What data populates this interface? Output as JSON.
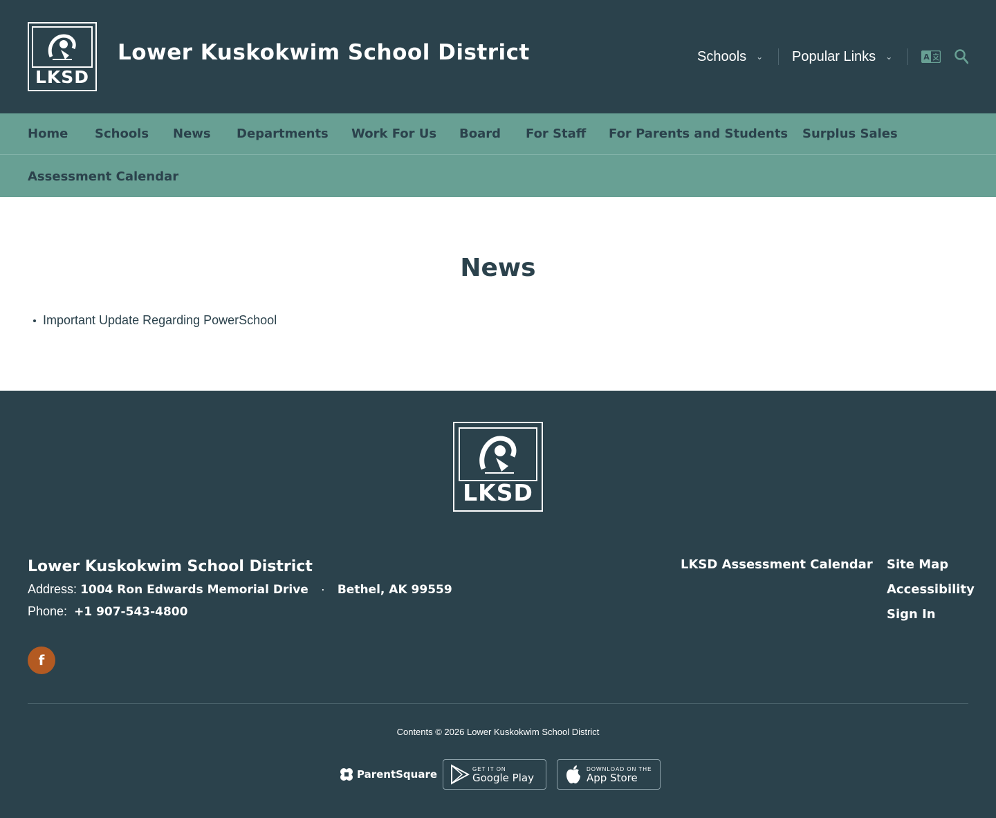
{
  "header": {
    "logo_text": "LKSD",
    "title": "Lower Kuskokwim School District",
    "utility": [
      {
        "label": "Schools"
      },
      {
        "label": "Popular Links"
      }
    ]
  },
  "nav": {
    "items": [
      "Home",
      "Schools",
      "News",
      "Departments",
      "Work For Us",
      "Board",
      "For Staff",
      "For Parents and Students",
      "Surplus Sales",
      "Assessment Calendar"
    ]
  },
  "main": {
    "title": "News",
    "items": [
      "Important Update Regarding PowerSchool"
    ]
  },
  "footer": {
    "logo_text": "LKSD",
    "name": "Lower Kuskokwim School District",
    "address_label": "Address:",
    "address_street": "1004 Ron Edwards Memorial Drive",
    "address_sep": "·",
    "address_city": "Bethel, AK 99559",
    "phone_label": "Phone:",
    "phone": "+1 907-543-4800",
    "facebook_glyph": "f",
    "links": [
      "LKSD Assessment Calendar",
      "Site Map",
      "Accessibility",
      "Sign In"
    ],
    "copyright": "Contents © 2026 Lower Kuskokwim School District",
    "parentsquare": "ParentSquare",
    "google_small": "GET IT ON",
    "google_big": "Google Play",
    "apple_small": "DOWNLOAD ON THE",
    "apple_big": "App Store"
  },
  "colors": {
    "header_bg": "#2b424c",
    "nav_bg": "#68a094",
    "facebook": "#b35a22"
  }
}
